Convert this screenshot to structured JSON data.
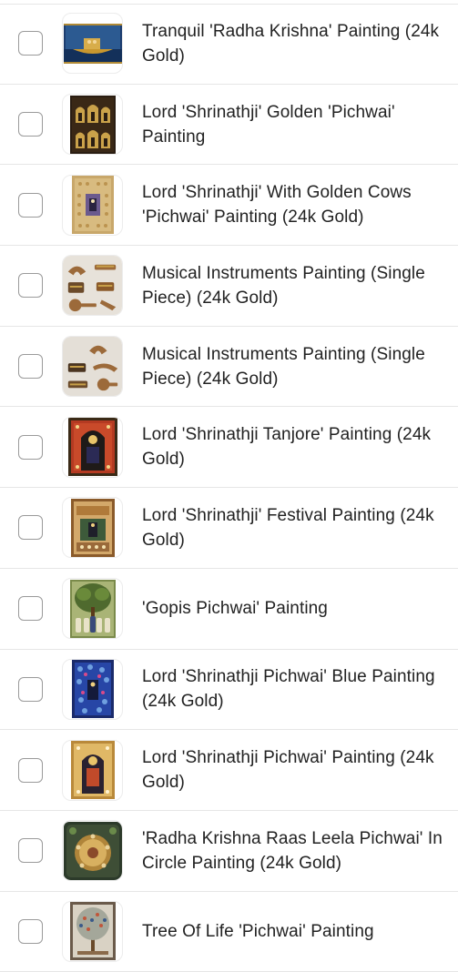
{
  "products": [
    {
      "title": "Tranquil 'Radha Krishna' Painting (24k Gold)",
      "thumb_icon": "boat-painting-icon",
      "checked": false
    },
    {
      "title": "Lord 'Shrinathji' Golden 'Pichwai' Painting",
      "thumb_icon": "golden-arches-painting-icon",
      "checked": false
    },
    {
      "title": "Lord 'Shrinathji' With Golden Cows 'Pichwai' Painting (24k Gold)",
      "thumb_icon": "golden-cows-painting-icon",
      "checked": false
    },
    {
      "title": "Musical Instruments Painting (Single Piece) (24k Gold)",
      "thumb_icon": "instruments-painting-icon",
      "checked": false
    },
    {
      "title": "Musical Instruments Painting (Single Piece) (24k Gold)",
      "thumb_icon": "instruments-painting-icon",
      "checked": false
    },
    {
      "title": "Lord 'Shrinathji Tanjore' Painting (24k Gold)",
      "thumb_icon": "tanjore-painting-icon",
      "checked": false
    },
    {
      "title": "Lord 'Shrinathji' Festival Painting (24k Gold)",
      "thumb_icon": "festival-painting-icon",
      "checked": false
    },
    {
      "title": "'Gopis Pichwai' Painting",
      "thumb_icon": "gopis-painting-icon",
      "checked": false
    },
    {
      "title": "Lord 'Shrinathji Pichwai' Blue Painting (24k Gold)",
      "thumb_icon": "blue-pichwai-painting-icon",
      "checked": false
    },
    {
      "title": "Lord 'Shrinathji Pichwai' Painting (24k Gold)",
      "thumb_icon": "pichwai-painting-icon",
      "checked": false
    },
    {
      "title": "'Radha Krishna Raas Leela Pichwai' In Circle Painting (24k Gold)",
      "thumb_icon": "raas-leela-painting-icon",
      "checked": false
    },
    {
      "title": "Tree Of Life 'Pichwai' Painting",
      "thumb_icon": "tree-of-life-painting-icon",
      "checked": false
    }
  ]
}
